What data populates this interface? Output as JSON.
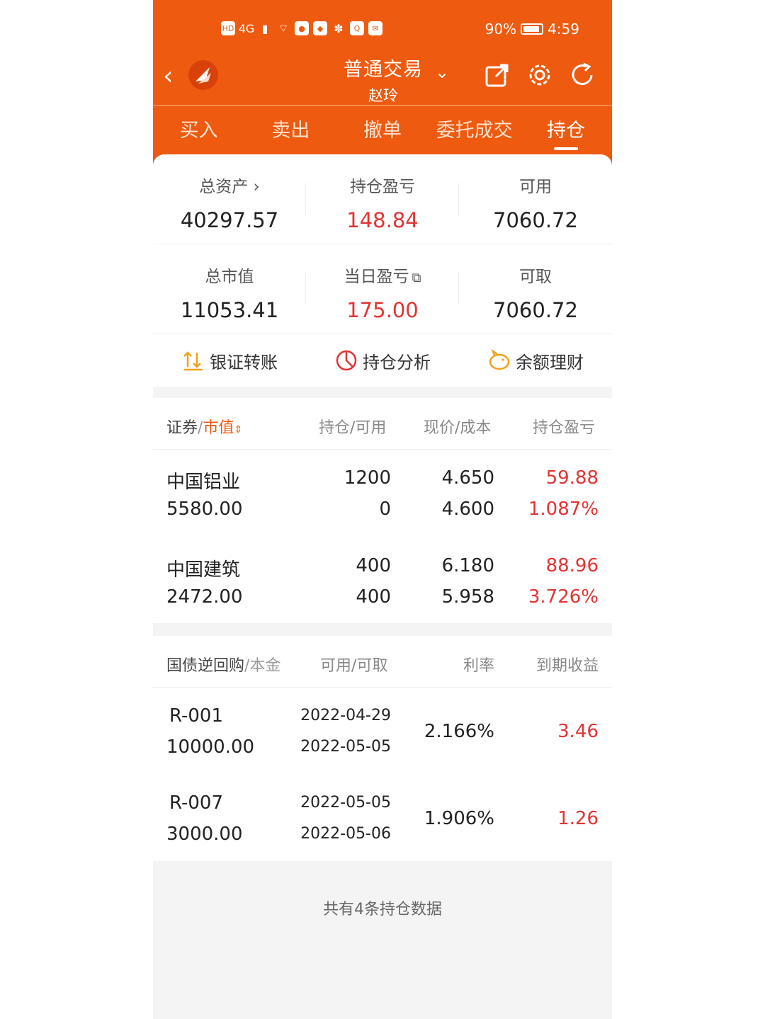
{
  "status_bar": {
    "left_icons": [
      "HD",
      "4G",
      "signal-icon",
      "wifi-icon",
      "app-icon",
      "app-icon",
      "wechat-icon",
      "app-icon",
      "app-icon"
    ],
    "battery": "90%",
    "time": "4:59"
  },
  "nav": {
    "title": "普通交易",
    "subtitle": "赵玲"
  },
  "tabs": [
    {
      "label": "买入"
    },
    {
      "label": "卖出"
    },
    {
      "label": "撤单"
    },
    {
      "label": "委托成交"
    },
    {
      "label": "持仓"
    }
  ],
  "summary": {
    "total_assets_label": "总资产",
    "total_assets": "40297.57",
    "position_pl_label": "持仓盈亏",
    "position_pl": "148.84",
    "available_label": "可用",
    "available": "7060.72",
    "market_value_label": "总市值",
    "market_value": "11053.41",
    "daily_pl_label": "当日盈亏",
    "daily_pl": "175.00",
    "withdrawable_label": "可取",
    "withdrawable": "7060.72"
  },
  "shortcuts": [
    {
      "label": "银证转账"
    },
    {
      "label": "持仓分析"
    },
    {
      "label": "余额理财"
    }
  ],
  "holdings": {
    "headers": {
      "security": "证券",
      "slash": "/",
      "market_value": "市值",
      "position": "持仓/可用",
      "price": "现价/成本",
      "pl": "持仓盈亏"
    },
    "rows": [
      {
        "name": "中国铝业",
        "value": "5580.00",
        "qty": "1200",
        "avail": "0",
        "price": "4.650",
        "cost": "4.600",
        "pl": "59.88",
        "pl_pct": "1.087%"
      },
      {
        "name": "中国建筑",
        "value": "2472.00",
        "qty": "400",
        "avail": "400",
        "price": "6.180",
        "cost": "5.958",
        "pl": "88.96",
        "pl_pct": "3.726%"
      }
    ]
  },
  "repo": {
    "headers": {
      "name": "国债逆回购",
      "principal": "/本金",
      "dates": "可用/可取",
      "rate": "利率",
      "yield": "到期收益"
    },
    "rows": [
      {
        "code": "R-001",
        "principal": "10000.00",
        "date1": "2022-04-29",
        "date2": "2022-05-05",
        "rate": "2.166%",
        "income": "3.46"
      },
      {
        "code": "R-007",
        "principal": "3000.00",
        "date1": "2022-05-05",
        "date2": "2022-05-06",
        "rate": "1.906%",
        "income": "1.26"
      }
    ]
  },
  "footer": "共有4条持仓数据",
  "colors": {
    "brand": "#ee5a0f",
    "profit": "#e33434"
  }
}
